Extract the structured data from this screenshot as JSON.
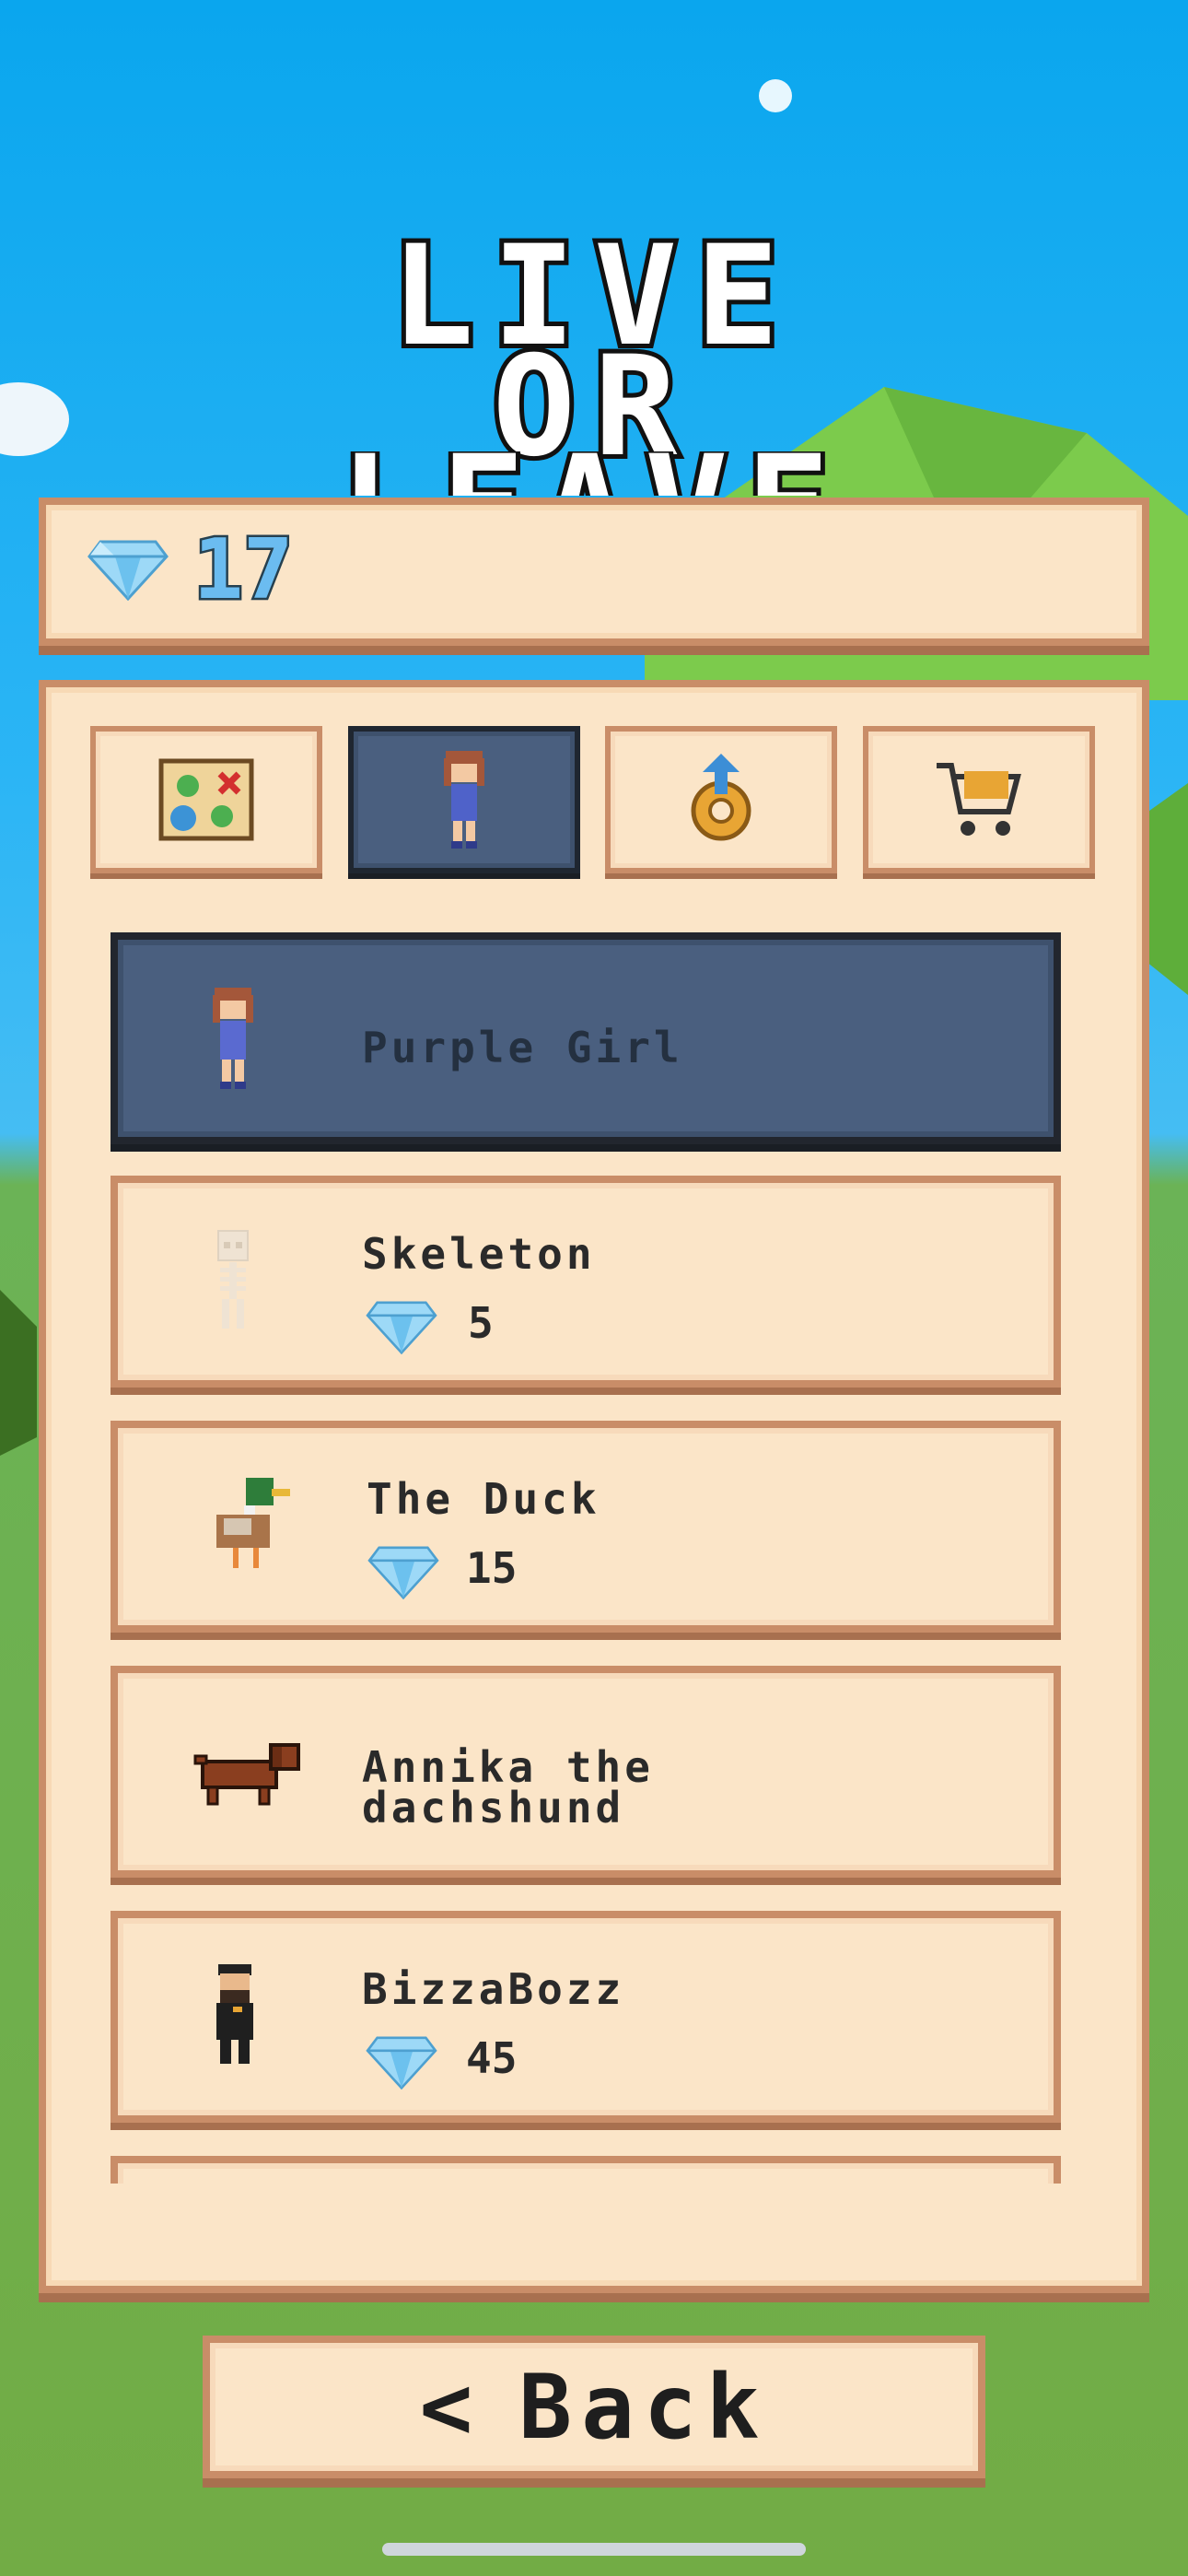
{
  "title_lines": [
    "LIVE",
    "OR",
    "LEAVE"
  ],
  "wallet": {
    "gem_count": "17",
    "icon": "diamond-icon"
  },
  "tabs": [
    {
      "id": "map",
      "icon": "treasure-map-icon",
      "active": false
    },
    {
      "id": "characters",
      "icon": "character-icon",
      "active": true
    },
    {
      "id": "upgrades",
      "icon": "gear-upgrade-icon",
      "active": false
    },
    {
      "id": "shop",
      "icon": "shopping-cart-icon",
      "active": false
    }
  ],
  "characters": [
    {
      "name": "Purple Girl",
      "price": "",
      "selected": true,
      "icon": "purple-girl-avatar"
    },
    {
      "name": "Skeleton",
      "price": "5",
      "selected": false,
      "icon": "skeleton-avatar"
    },
    {
      "name": "The Duck",
      "price": "15",
      "selected": false,
      "icon": "duck-avatar"
    },
    {
      "name": "Annika the dachshund",
      "price": "",
      "selected": false,
      "icon": "dachshund-avatar"
    },
    {
      "name": "BizzaBozz",
      "price": "45",
      "selected": false,
      "icon": "bizzabozz-avatar"
    }
  ],
  "back_button": {
    "label": "Back",
    "icon": "chevron-left-icon"
  },
  "colors": {
    "panel": "#fbe5c8",
    "border": "#c98d68",
    "active": "#4a5f7f",
    "gem": "#6bbcf0"
  }
}
